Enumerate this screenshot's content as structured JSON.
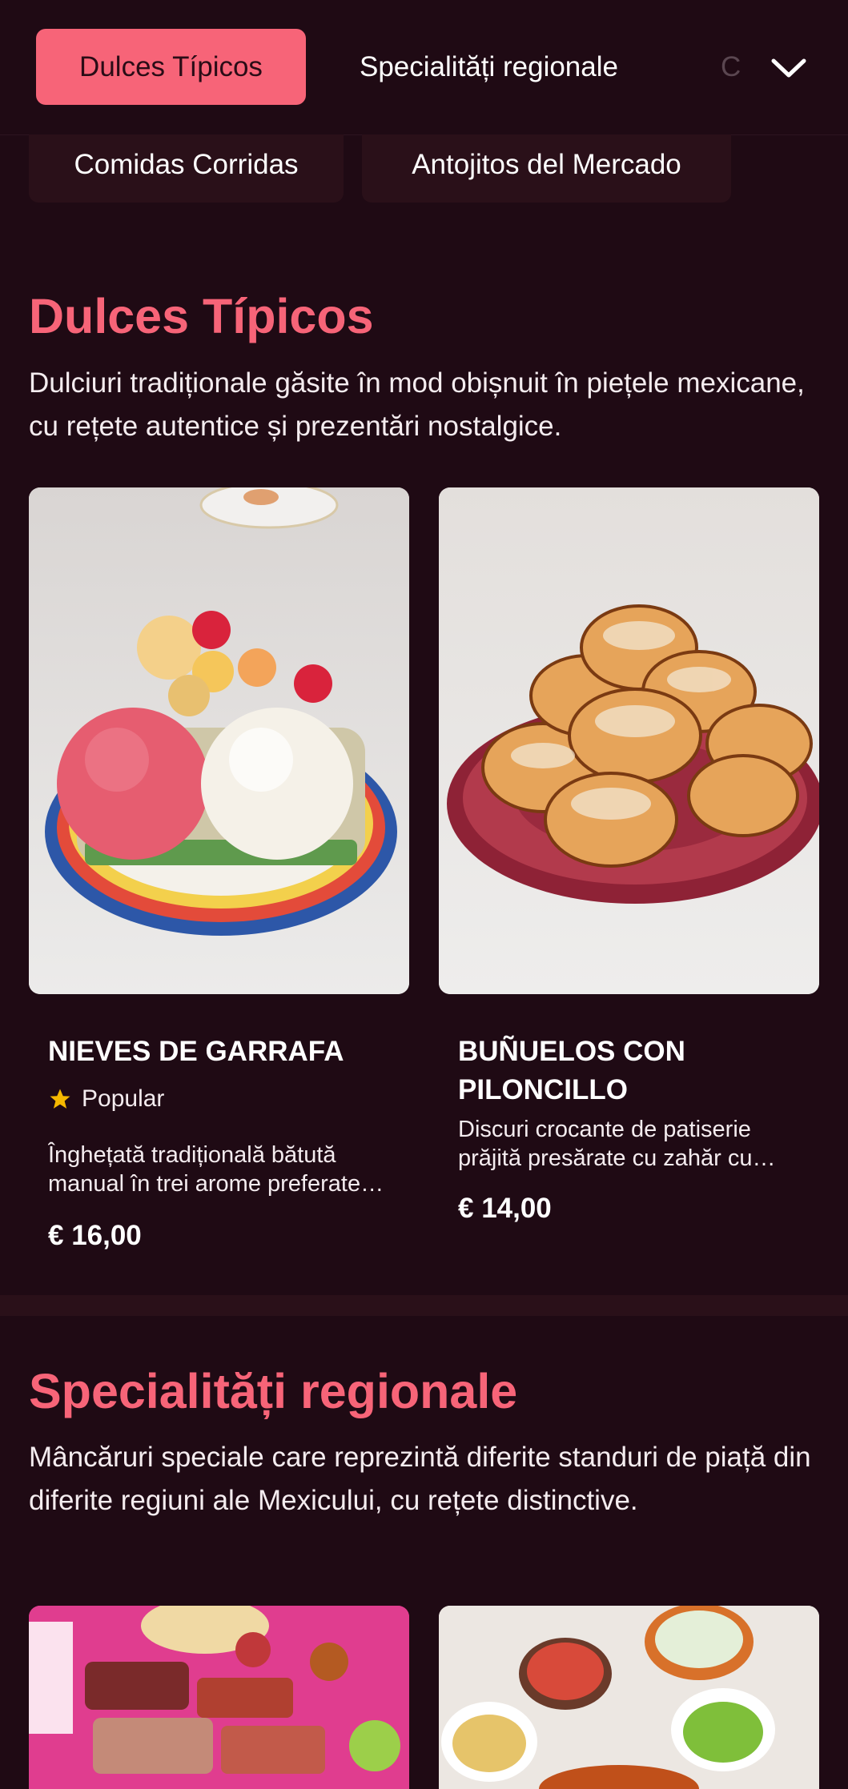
{
  "tabs": {
    "active": "Dulces Típicos",
    "items": [
      "Specialități regionale"
    ],
    "overflow_partial": "C",
    "more_icon": "chevron-down-icon"
  },
  "chips": [
    "Comidas Corridas",
    "Antojitos del Mercado"
  ],
  "sections": [
    {
      "title": "Dulces Típicos",
      "description": "Dulciuri tradiționale găsite în mod obișnuit în piețele mexicane, cu rețete autentice și prezentări nostalgice.",
      "items": [
        {
          "name": "NIEVES DE GARRAFA",
          "badge": "Popular",
          "badge_icon": "star-icon",
          "description": "Înghețată tradițională bătută manual în trei arome preferate de nieve de garrafa.",
          "price": "€ 16,00"
        },
        {
          "name": "BUÑUELOS CON PILONCILLO",
          "description": "Discuri crocante de patiserie prăjită presărate cu zahăr cu sirop de piloncillo.",
          "price": "€ 14,00"
        }
      ]
    },
    {
      "title": "Specialități regionale",
      "description": "Mâncăruri speciale care reprezintă diferite standuri de piață din diferite regiuni ale Mexicului, cu rețete distinctive."
    }
  ],
  "colors": {
    "background": "#1f0a14",
    "accent": "#f76478",
    "surface": "#2a1019",
    "star": "#f5b800"
  }
}
